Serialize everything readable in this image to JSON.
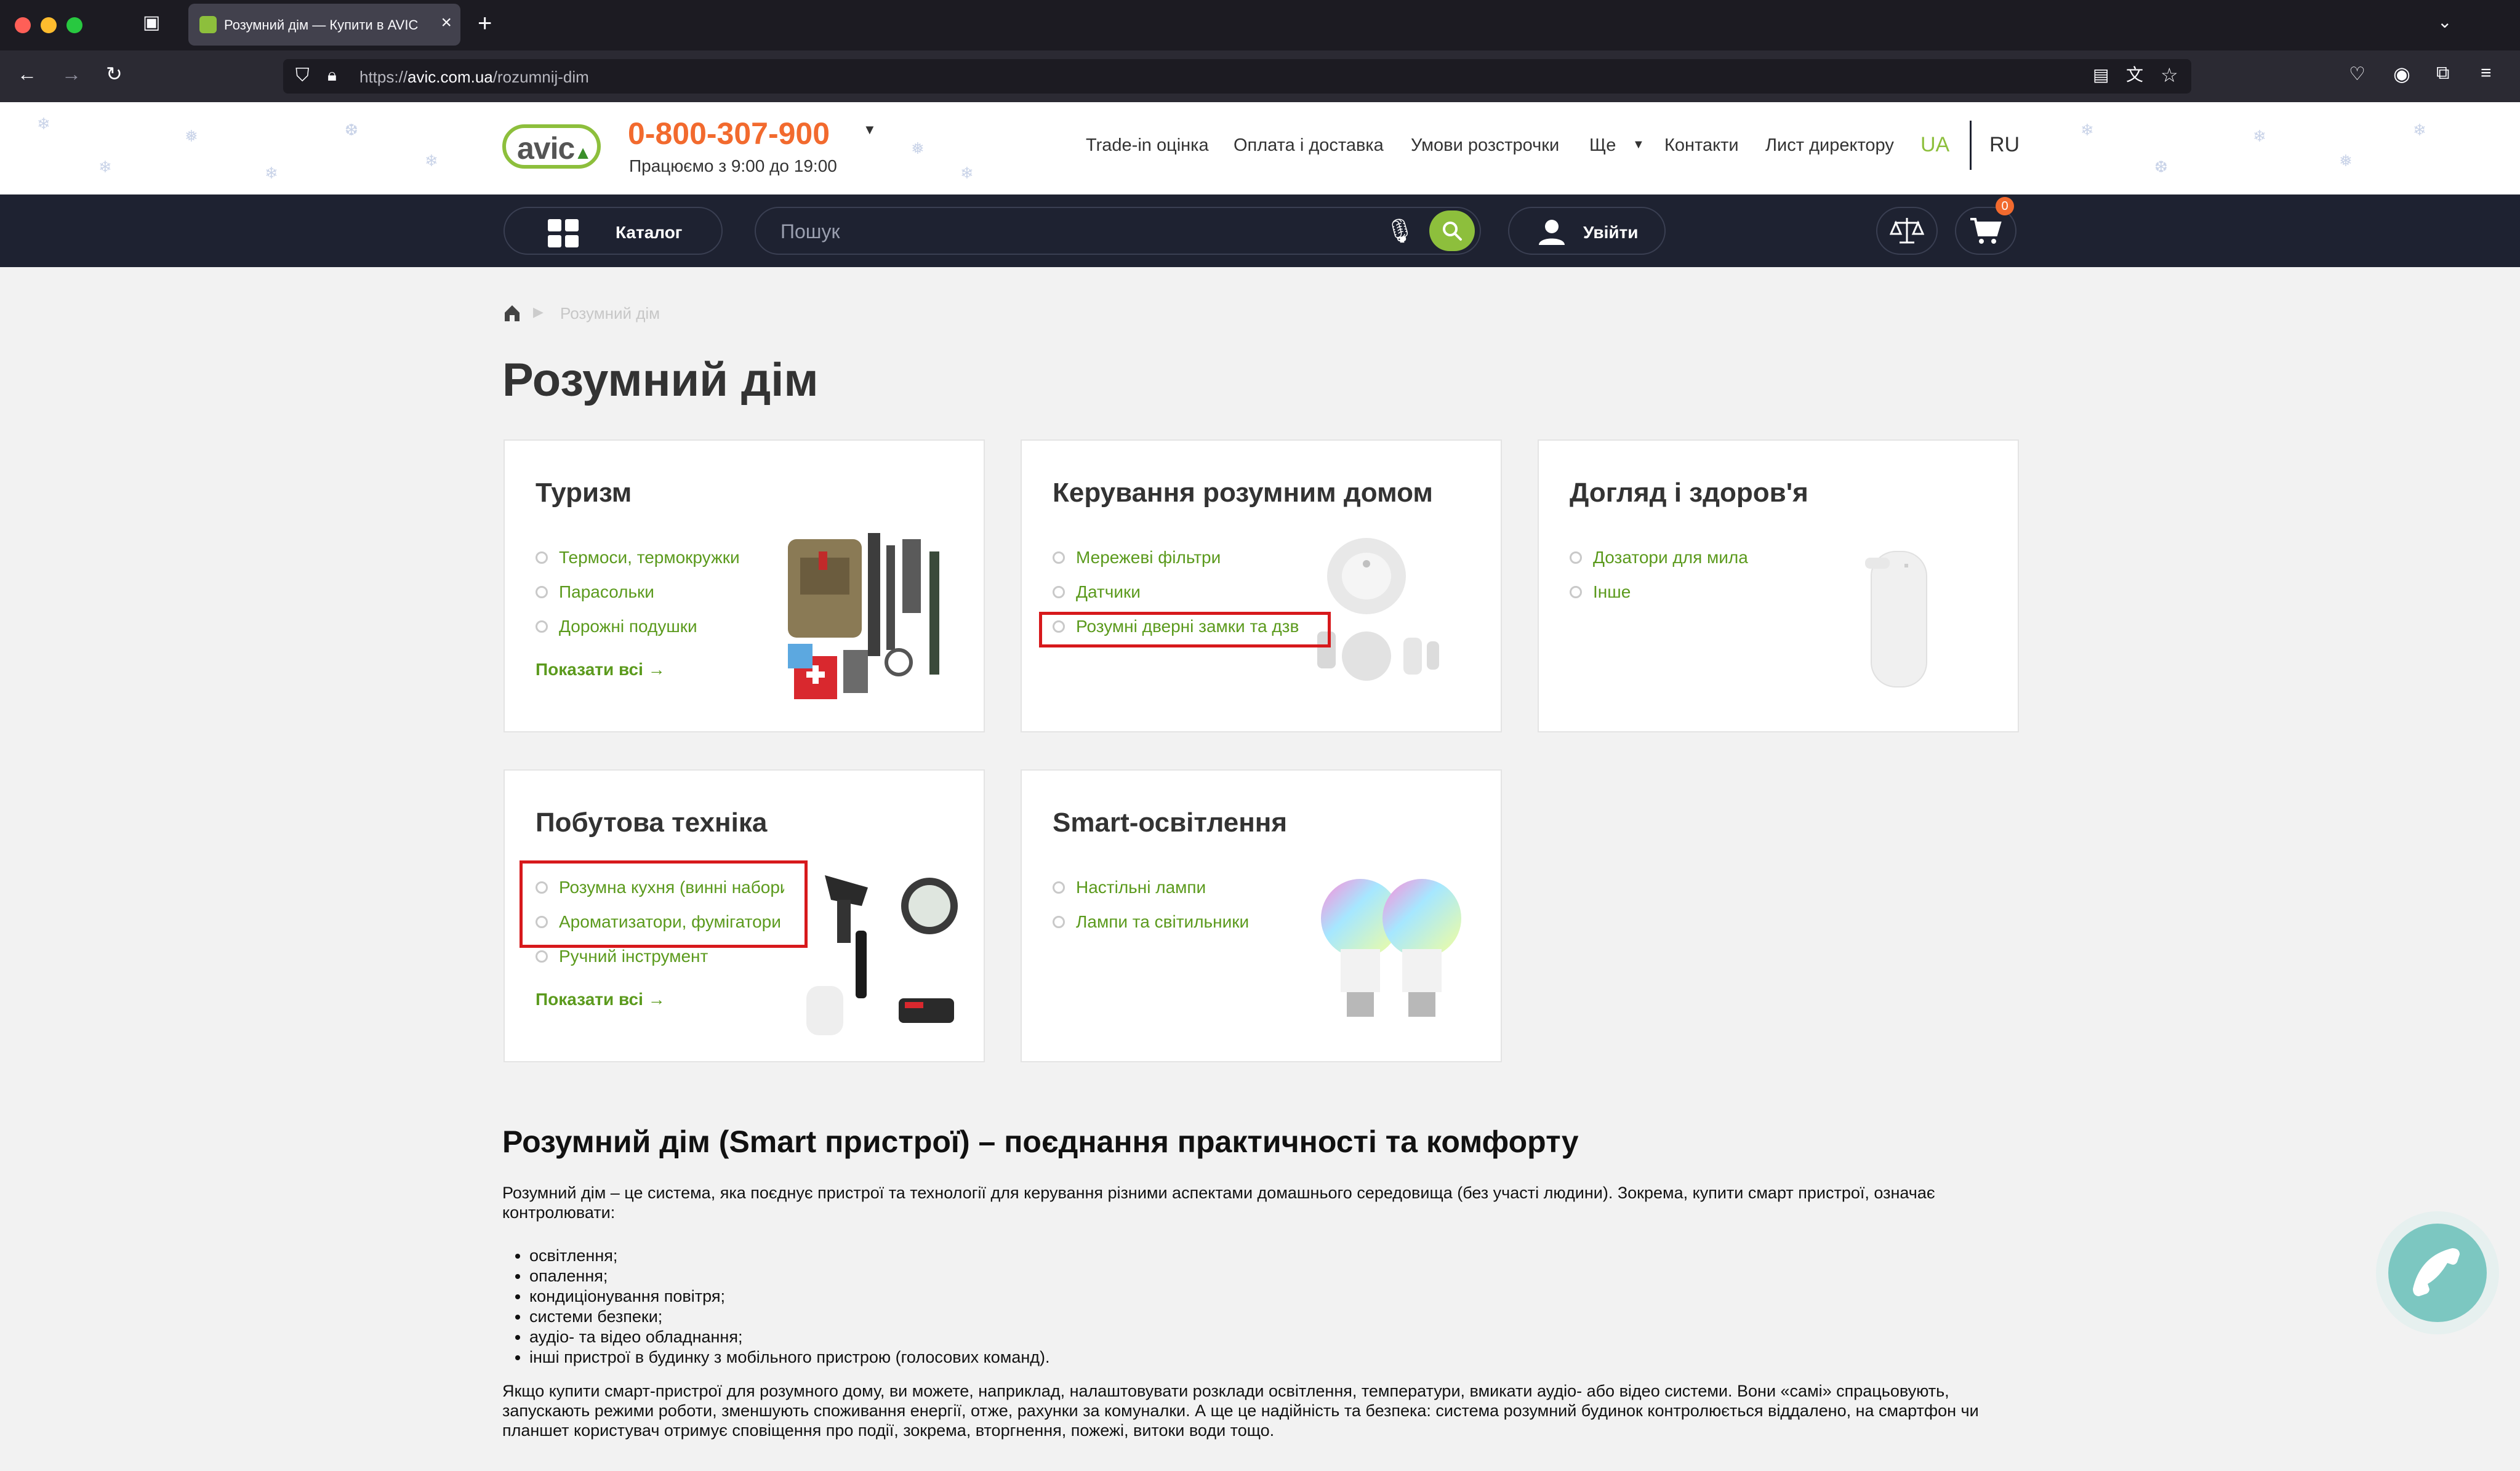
{
  "browser": {
    "tab_title": "Розумний дім — Купити в AVIC",
    "url_prefix": "https://",
    "url_domain": "avic.com.ua",
    "url_path": "/rozumnij-dim"
  },
  "header": {
    "phone": "0-800-307-900",
    "hours": "Працюємо з 9:00 до 19:00",
    "links": [
      "Trade-in оцінка",
      "Оплата і доставка",
      "Умови розстрочки",
      "Ще",
      "Контакти",
      "Лист директору"
    ],
    "lang_ua": "UA",
    "lang_ru": "RU"
  },
  "toolbar": {
    "catalog_label": "Каталог",
    "search_placeholder": "Пошук",
    "login_label": "Увійти",
    "cart_count": "0"
  },
  "breadcrumb": {
    "current": "Розумний дім"
  },
  "page_title": "Розумний дім",
  "categories": [
    {
      "title": "Туризм",
      "items": [
        "Термоси, термокружки",
        "Парасольки",
        "Дорожні подушки"
      ],
      "show_all": "Показати всі →"
    },
    {
      "title": "Керування розумним домом",
      "items": [
        "Мережеві фільтри",
        "Датчики",
        "Розумні дверні замки та дзвінки"
      ]
    },
    {
      "title": "Догляд і здоров'я",
      "items": [
        "Дозатори для мила",
        "Інше"
      ]
    },
    {
      "title": "Побутова техніка",
      "items": [
        "Розумна кухня (винні набори)",
        "Ароматизатори, фумігатори",
        "Ручний інструмент"
      ],
      "show_all": "Показати всі →"
    },
    {
      "title": "Smart-освітлення",
      "items": [
        "Настільні лампи",
        "Лампи та світильники"
      ]
    }
  ],
  "seo": {
    "title": "Розумний дім (Smart пристрої) – поєднання практичності та комфорту",
    "intro": "Розумний дім – це система, яка поєднує пристрої та технології для керування різними аспектами домашнього середовища (без участі людини). Зокрема, купити смарт пристрої, означає контролювати:",
    "list": [
      "освітлення;",
      "опалення;",
      "кондиціонування повітря;",
      "системи безпеки;",
      "аудіо- та відео обладнання;",
      "інші пристрої в будинку з мобільного пристрою (голосових команд)."
    ],
    "paragraph": "Якщо купити смарт-пристрої для розумного дому, ви можете, наприклад, налаштовувати розклади освітлення, температури, вмикати аудіо- або відео системи. Вони «самі» спрацьовують, запускають режими роботи, зменшують споживання енергії, отже, рахунки за комуналки. А ще це надійність та безпека: система розумний будинок контролюється віддалено, на смартфон чи планшет користувач отримує сповіщення про події, зокрема, вторгнення, пожежі, витоки води тощо."
  },
  "colors": {
    "accent_green": "#8dbf3c",
    "link_green": "#5b9a1d",
    "phone_orange": "#f26a2e",
    "dark_bar": "#1e2231",
    "highlight_red": "#d7191c"
  }
}
